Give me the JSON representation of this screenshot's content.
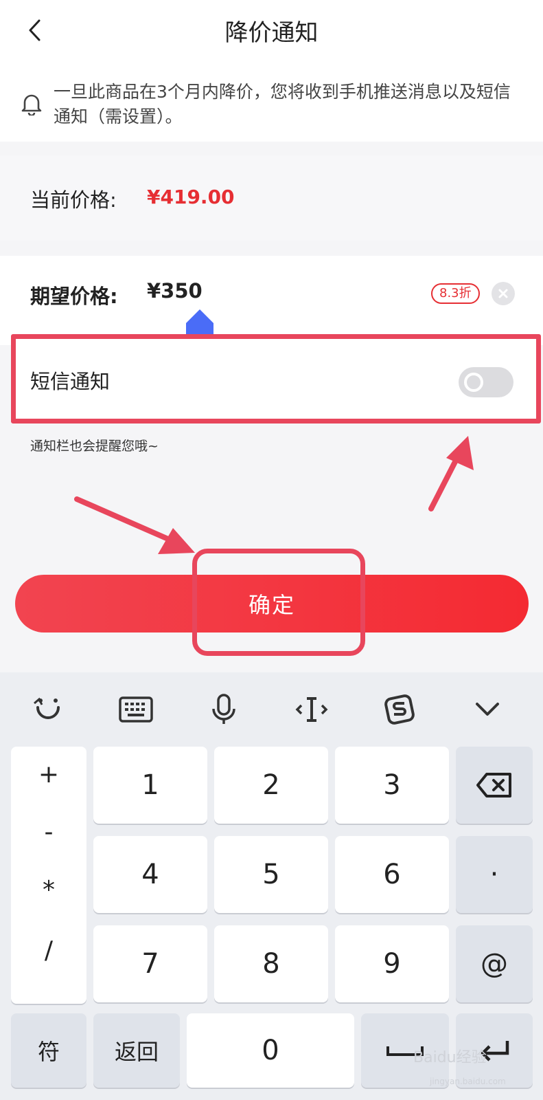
{
  "header": {
    "title": "降价通知"
  },
  "notice": {
    "text": "一旦此商品在3个月内降价，您将收到手机推送消息以及短信通知（需设置）。"
  },
  "current_price": {
    "label": "当前价格:",
    "value": "¥419.00"
  },
  "expected_price": {
    "label": "期望价格:",
    "value": "¥350",
    "discount": "8.3折"
  },
  "sms": {
    "label": "短信通知",
    "enabled": false,
    "hint": "通知栏也会提醒您哦~"
  },
  "confirm": {
    "label": "确定"
  },
  "keyboard": {
    "toolbar_icons": [
      "emoji-face-icon",
      "keyboard-icon",
      "microphone-icon",
      "text-cursor-icon",
      "sogou-logo-icon",
      "chevron-down-icon"
    ],
    "symbols": [
      "+",
      "-",
      "*",
      "/"
    ],
    "keys": {
      "k1": "1",
      "k2": "2",
      "k3": "3",
      "k4": "4",
      "k5": "5",
      "k6": "6",
      "k7": "7",
      "k8": "8",
      "k9": "9",
      "k0": "0",
      "dot": "·",
      "at": "@",
      "symbols_switch": "符",
      "back": "返回"
    }
  },
  "watermark": {
    "text": "Baidu经验",
    "sub": "jingyan.baidu.com"
  },
  "colors": {
    "accent": "#e62e33",
    "annotation": "#e8465c",
    "cursor": "#4a6cf7"
  }
}
